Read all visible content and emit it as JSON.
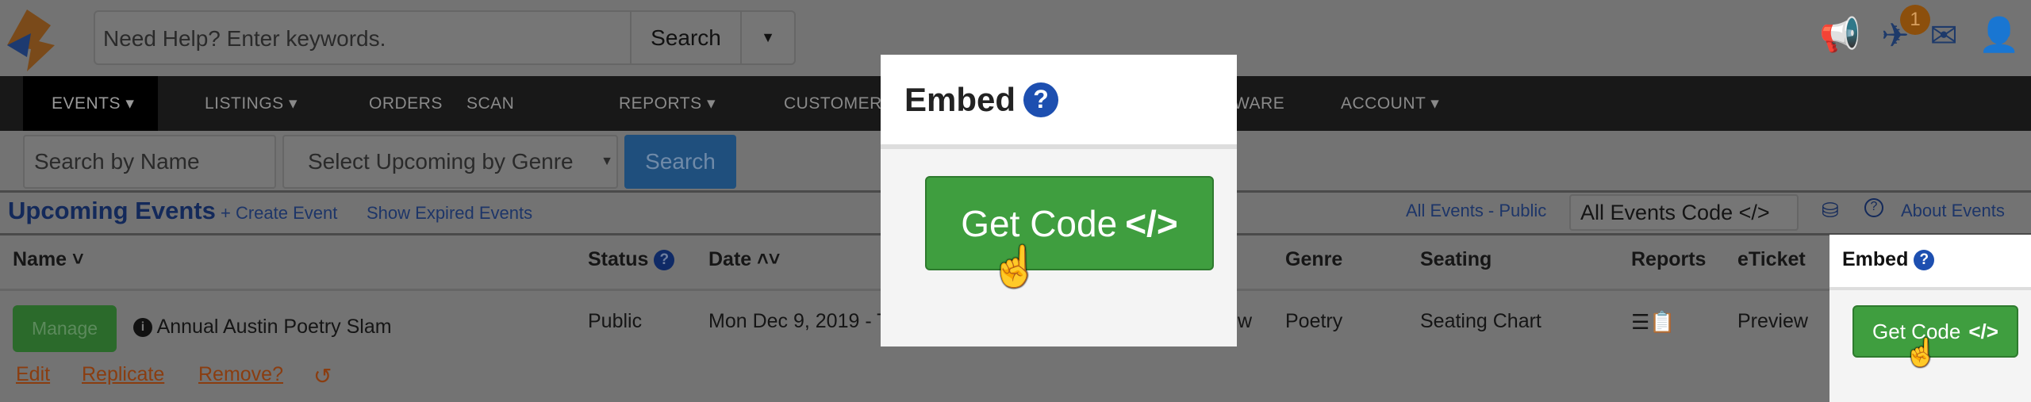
{
  "header": {
    "help_placeholder": "Need Help? Enter keywords.",
    "search_label": "Search",
    "notification_count": "1"
  },
  "nav": {
    "items": [
      "EVENTS ▾",
      "LISTINGS ▾",
      "ORDERS",
      "SCAN",
      "REPORTS ▾",
      "CUSTOMERS",
      "WARE",
      "ACCOUNT ▾"
    ]
  },
  "filters": {
    "name_placeholder": "Search by Name",
    "genre_select": "Select Upcoming by Genre",
    "search_label": "Search"
  },
  "section": {
    "title": "Upcoming Events",
    "create": "+ Create Event",
    "show_expired": "Show Expired Events",
    "all_public": "All Events - Public",
    "all_code": "All Events Code </>",
    "about": "About Events"
  },
  "table": {
    "headers": {
      "name": "Name ˅",
      "status": "Status",
      "date": "Date ˄˅",
      "genre": "Genre",
      "seating": "Seating",
      "reports": "Reports",
      "eticket": "eTicket",
      "embed": "Embed"
    },
    "row": {
      "manage": "Manage",
      "name": "Annual Austin Poetry Slam",
      "status": "Public",
      "date": "Mon Dec 9, 2019 - T",
      "view_fragment": "w",
      "genre": "Poetry",
      "seating": "Seating Chart",
      "eticket": "Preview",
      "embed": "Get Code"
    },
    "actions": {
      "edit": "Edit",
      "replicate": "Replicate",
      "remove": "Remove?"
    }
  },
  "popup": {
    "title": "Embed",
    "button": "Get Code"
  },
  "colors": {
    "green": "#3f9e3f",
    "blue": "#1d4fb0",
    "overlay": "#737373"
  }
}
